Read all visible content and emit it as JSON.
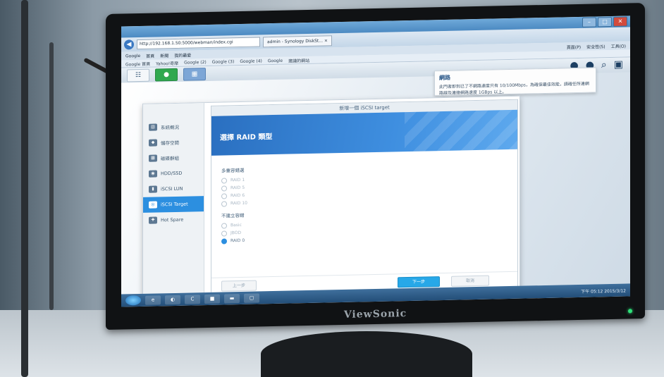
{
  "window": {
    "controls": [
      "–",
      "□",
      "✕"
    ]
  },
  "browser": {
    "back_glyph": "◀",
    "url": "http://192.168.1.50:5000/webman/index.cgi",
    "tab_label": "admin - Synology DiskSt... ×",
    "menu": [
      "Google",
      "首頁",
      "新聞",
      "我的最愛",
      "頁面(P)",
      "安全性(S)",
      "工具(O)"
    ],
    "favorites": [
      "Google 首頁",
      "Yahoo!奇摩",
      "Google (2)",
      "Google (3)",
      "Google (4)",
      "Google",
      "建議的網站"
    ]
  },
  "dsm_bar": {
    "main_menu_glyph": "☷",
    "right_icons": [
      "●",
      "●",
      "⌕",
      "▣"
    ]
  },
  "notification": {
    "title": "網路",
    "body": "此門者即到已了不網路速度只有 10/100Mbps，為確保最佳效能，請確任所連網路線及連接網路速度 1GBps 以上。"
  },
  "storage_manager": {
    "sidebar": [
      {
        "label": "系統概況",
        "icon": "▤"
      },
      {
        "label": "儲存空間",
        "icon": "◆"
      },
      {
        "label": "磁碟群組",
        "icon": "▦"
      },
      {
        "label": "HDD/SSD",
        "icon": "◉"
      },
      {
        "label": "iSCSI LUN",
        "icon": "▮"
      },
      {
        "label": "iSCSI Target",
        "icon": "◎"
      },
      {
        "label": "Hot Spare",
        "icon": "✚"
      }
    ],
    "active_index": 5
  },
  "wizard": {
    "window_title": "新增一個 iSCSI target",
    "banner_title": "選擇 RAID 類型",
    "section1_label": "多重容錯選",
    "group1": [
      "RAID 1",
      "RAID 5",
      "RAID 6",
      "RAID 10"
    ],
    "section2_label": "不建立容錯",
    "group2": [
      "Basic",
      "JBOD",
      "RAID 0"
    ],
    "selected": "RAID 0",
    "prev_label": "上一步",
    "next_label": "下一步",
    "cancel_label": "取消"
  },
  "taskbar": {
    "items": [
      "e",
      "◐",
      "C",
      "■",
      "▬",
      "▢"
    ],
    "clock": "下午 05:12  2015/3/12"
  },
  "monitor": {
    "brand": "ViewSonic"
  }
}
